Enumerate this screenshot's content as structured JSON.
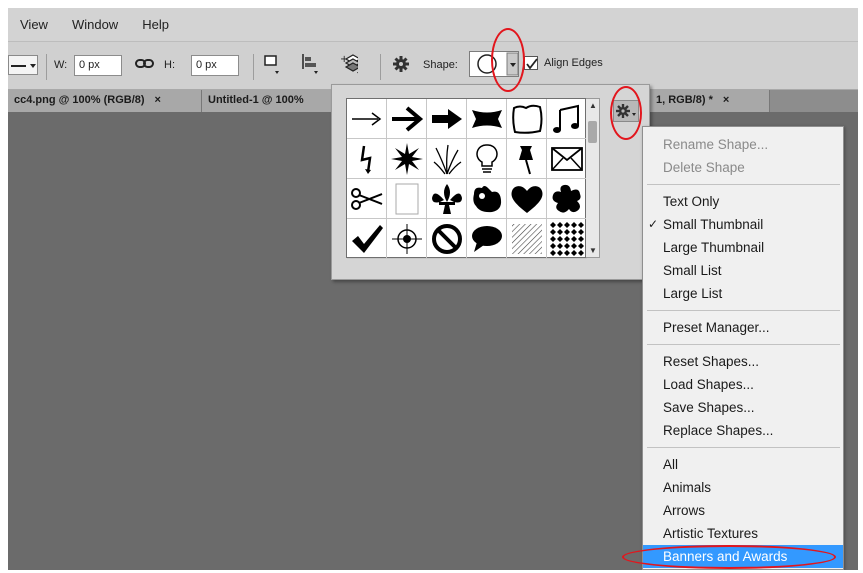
{
  "menubar": {
    "items": [
      "View",
      "Window",
      "Help"
    ]
  },
  "options": {
    "width_label": "W:",
    "width_value": "0 px",
    "height_label": "H:",
    "height_value": "0 px",
    "shape_label": "Shape:",
    "align_edges_label": "Align Edges",
    "align_edges_checked": true
  },
  "tabs": [
    {
      "label": "cc4.png @ 100% (RGB/8)",
      "close": "×"
    },
    {
      "label": "Untitled-1 @ 100%",
      "close": ""
    },
    {
      "label": "1, RGB/8) *",
      "close": "×"
    }
  ],
  "shape_picker": {
    "shapes": [
      "arrow-thin",
      "arrow-bold",
      "arrow-solid",
      "banner",
      "frame",
      "music-note",
      "lightning",
      "starburst",
      "grass",
      "lightbulb",
      "thumbtack",
      "envelope",
      "scissors",
      "blank-page",
      "fleur-de-lis",
      "puzzle-bird",
      "heart",
      "splat",
      "checkmark",
      "target",
      "no-sign",
      "speech-bubble",
      "hatched-square",
      "diamond-grid"
    ]
  },
  "context_menu": {
    "groups": [
      [
        {
          "label": "Rename Shape...",
          "disabled": true
        },
        {
          "label": "Delete Shape",
          "disabled": true
        }
      ],
      [
        {
          "label": "Text Only"
        },
        {
          "label": "Small Thumbnail",
          "checked": true
        },
        {
          "label": "Large Thumbnail"
        },
        {
          "label": "Small List"
        },
        {
          "label": "Large List"
        }
      ],
      [
        {
          "label": "Preset Manager..."
        }
      ],
      [
        {
          "label": "Reset Shapes..."
        },
        {
          "label": "Load Shapes..."
        },
        {
          "label": "Save Shapes..."
        },
        {
          "label": "Replace Shapes..."
        }
      ],
      [
        {
          "label": "All"
        },
        {
          "label": "Animals"
        },
        {
          "label": "Arrows"
        },
        {
          "label": "Artistic Textures"
        },
        {
          "label": "Banners and Awards",
          "highlighted": true
        }
      ]
    ],
    "check_glyph": "✓"
  },
  "colors": {
    "highlight": "#3399ff",
    "annotation": "#e2161d",
    "canvas": "#6b6b6b"
  }
}
